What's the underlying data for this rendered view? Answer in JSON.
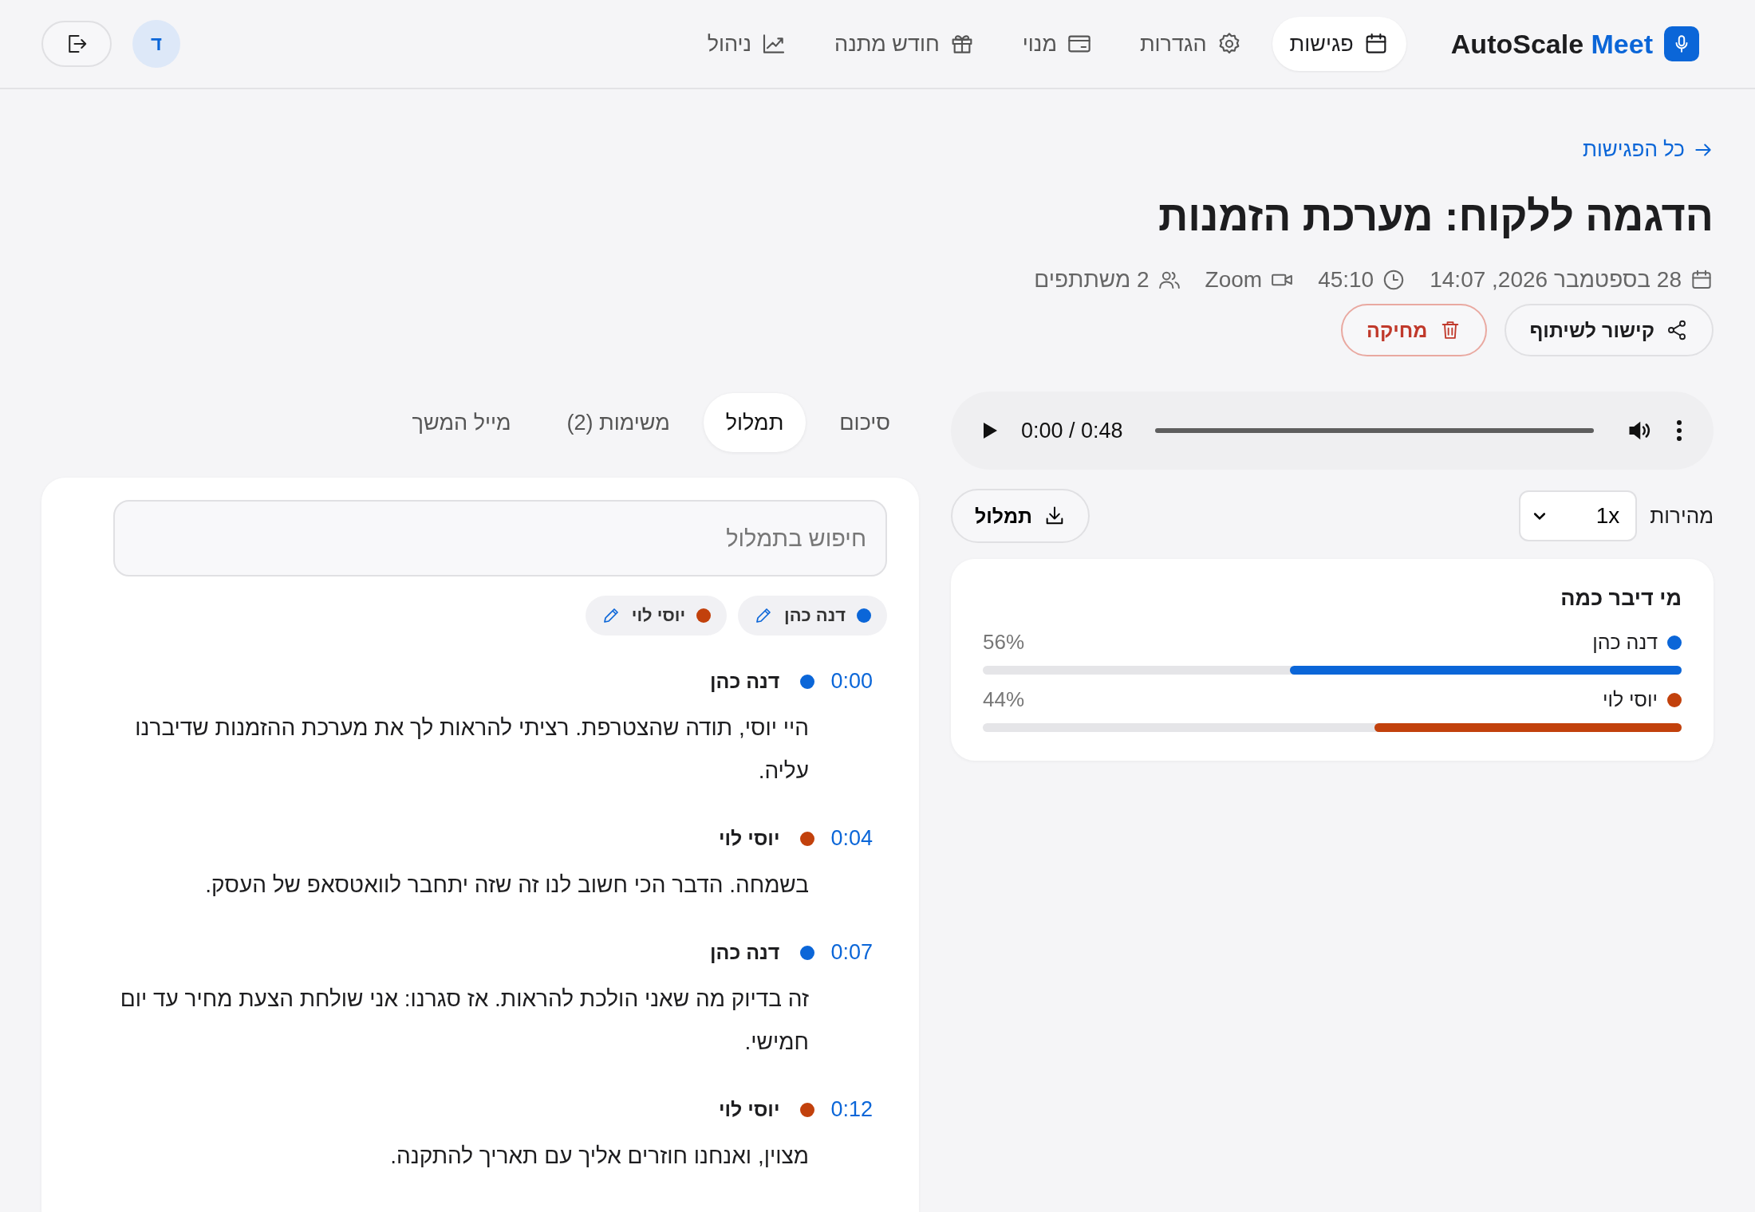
{
  "brand": {
    "name": "AutoScale",
    "accent": "Meet"
  },
  "nav": [
    {
      "kind": "calendar",
      "label": "פגישות",
      "selected": true
    },
    {
      "kind": "gear",
      "label": "הגדרות",
      "selected": false
    },
    {
      "kind": "card",
      "label": "מנוי",
      "selected": false
    },
    {
      "kind": "gift",
      "label": "חודש מתנה",
      "selected": false
    },
    {
      "kind": "chart",
      "label": "ניהול",
      "selected": false
    }
  ],
  "user": {
    "initial": "ד"
  },
  "back_link": "כל הפגישות",
  "title": "הדגמה ללקוח: מערכת הזמנות",
  "meta": [
    {
      "kind": "date",
      "text": "28 בספטמבר 2026, 14:07"
    },
    {
      "kind": "duration",
      "text": "45:10"
    },
    {
      "kind": "platform",
      "text": "Zoom"
    },
    {
      "kind": "participants",
      "text": "2 משתתפים"
    }
  ],
  "actions": [
    {
      "kind": "share",
      "label": "קישור לשיתוף"
    },
    {
      "kind": "delete",
      "label": "מחיקה"
    }
  ],
  "player": {
    "time": "0:00 / 0:48",
    "level": 0
  },
  "speed": {
    "label": "מהירות",
    "value": "1x"
  },
  "download": {
    "label": "תמלול"
  },
  "talk_time": {
    "title": "מי דיבר כמה",
    "speakers": [
      {
        "name": "דנה כהן",
        "color": "#0b66d8",
        "percent": "56%",
        "level": 0.56
      },
      {
        "name": "יוסי לוי",
        "color": "#c2410c",
        "percent": "44%",
        "level": 0.44
      }
    ]
  },
  "tabs": [
    {
      "label": "סיכום",
      "selected": false
    },
    {
      "label": "תמלול",
      "selected": true
    },
    {
      "label": "משימות (2)",
      "selected": false
    },
    {
      "label": "מייל המשך",
      "selected": false
    }
  ],
  "search": {
    "placeholder": "חיפוש בתמלול"
  },
  "speaker_chips": [
    {
      "name": "דנה כהן",
      "color": "#0b66d8"
    },
    {
      "name": "יוסי לוי",
      "color": "#c2410c"
    }
  ],
  "transcript": [
    {
      "time": "0:00",
      "speaker": "דנה כהן",
      "color": "#0b66d8",
      "text": "היי יוסי, תודה שהצטרפת. רציתי להראות לך את מערכת ההזמנות שדיברנו עליה."
    },
    {
      "time": "0:04",
      "speaker": "יוסי לוי",
      "color": "#c2410c",
      "text": "בשמחה. הדבר הכי חשוב לנו זה שזה יתחבר לוואטסאפ של העסק."
    },
    {
      "time": "0:07",
      "speaker": "דנה כהן",
      "color": "#0b66d8",
      "text": "זה בדיוק מה שאני הולכת להראות. אז סגרנו: אני שולחת הצעת מחיר עד יום חמישי."
    },
    {
      "time": "0:12",
      "speaker": "יוסי לוי",
      "color": "#c2410c",
      "text": "מצוין, ואנחנו חוזרים אליך עם תאריך להתקנה."
    }
  ]
}
